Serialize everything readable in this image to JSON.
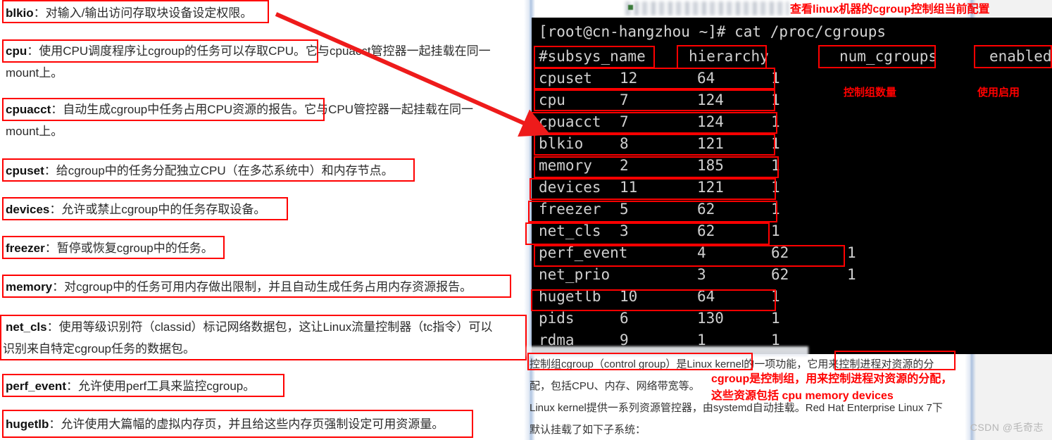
{
  "watermark": "CSDN @毛奇志",
  "article": {
    "entries": [
      {
        "key": "blkio",
        "sep": "：",
        "desc": "对输入/输出访问存取块设备设定权限。"
      },
      {
        "key": "cpu",
        "sep": "：",
        "desc": "使用CPU调度程序让cgroup的任务可以存取CPU。",
        "tail": "它与cpuacct管控器一起挂载在同一",
        "cont": "mount上。"
      },
      {
        "key": "cpuacct",
        "sep": "：",
        "desc": "自动生成cgroup中任务占用CPU资源的报告。",
        "tail": "它与CPU管控器一起挂载在同一",
        "cont": "mount上。"
      },
      {
        "key": "cpuset",
        "sep": "：",
        "desc": "给cgroup中的任务分配独立CPU（在多芯系统中）和内存节点。"
      },
      {
        "key": "devices",
        "sep": "：",
        "desc": "允许或禁止cgroup中的任务存取设备。"
      },
      {
        "key": "freezer",
        "sep": "：",
        "desc": "暂停或恢复cgroup中的任务。"
      },
      {
        "key": "memory",
        "sep": "：",
        "desc": "对cgroup中的任务可用内存做出限制，并且自动生成任务占用内存资源报告。"
      },
      {
        "key": "net_cls",
        "sep": "：",
        "desc": "使用等级识别符（classid）标记网络数据包，这让Linux流量控制器（tc指令）可以",
        "cont": "识别来自特定cgroup任务的数据包。"
      },
      {
        "key": "perf_event",
        "sep": "：",
        "desc": "允许使用perf工具来监控cgroup。"
      },
      {
        "key": "hugetlb",
        "sep": "：",
        "desc": "允许使用大篇幅的虚拟内存页，并且给这些内存页强制设定可用资源量。"
      }
    ]
  },
  "annotations": {
    "title": "查看linux机器的cgroup控制组当前配置",
    "num_cgroups_note": "控制组数量",
    "enabled_note": "使用启用",
    "summary_line1": "cgroup是控制组，用来控制进程对资源的分配，",
    "summary_line2": "这些资源包括 cpu memory devices"
  },
  "terminal": {
    "prompt": "[root@cn-hangzhou ~]# cat /proc/cgroups",
    "headers": {
      "subsys_name": "#subsys_name",
      "hierarchy": "hierarchy",
      "num_cgroups": "num_cgroups",
      "enabled": "enabled"
    },
    "rows": [
      {
        "subsys_name": "cpuset",
        "hierarchy": "12",
        "num_cgroups": "64",
        "enabled": "1",
        "layout": "a"
      },
      {
        "subsys_name": "cpu",
        "hierarchy": "7",
        "num_cgroups": "124",
        "enabled": "1",
        "layout": "a"
      },
      {
        "subsys_name": "cpuacct",
        "hierarchy": "7",
        "num_cgroups": "124",
        "enabled": "1",
        "layout": "a"
      },
      {
        "subsys_name": "blkio",
        "hierarchy": "8",
        "num_cgroups": "121",
        "enabled": "1",
        "layout": "a"
      },
      {
        "subsys_name": "memory",
        "hierarchy": "2",
        "num_cgroups": "185",
        "enabled": "1",
        "layout": "a"
      },
      {
        "subsys_name": "devices",
        "hierarchy": "11",
        "num_cgroups": "121",
        "enabled": "1",
        "layout": "a"
      },
      {
        "subsys_name": "freezer",
        "hierarchy": "5",
        "num_cgroups": "62",
        "enabled": "1",
        "layout": "a"
      },
      {
        "subsys_name": "net_cls",
        "hierarchy": "3",
        "num_cgroups": "62",
        "enabled": "1",
        "layout": "a"
      },
      {
        "subsys_name": "perf_event",
        "hierarchy": "4",
        "num_cgroups": "62",
        "enabled": "1",
        "layout": "b"
      },
      {
        "subsys_name": "net_prio",
        "hierarchy": "3",
        "num_cgroups": "62",
        "enabled": "1",
        "layout": "b"
      },
      {
        "subsys_name": "hugetlb",
        "hierarchy": "10",
        "num_cgroups": "64",
        "enabled": "1",
        "layout": "a"
      },
      {
        "subsys_name": "pids",
        "hierarchy": "6",
        "num_cgroups": "130",
        "enabled": "1",
        "layout": "a"
      },
      {
        "subsys_name": "rdma",
        "hierarchy": "9",
        "num_cgroups": "1",
        "enabled": "1",
        "layout": "a"
      }
    ]
  },
  "bottom_text": {
    "line1_a": "控制组cgroup（control group）",
    "line1_b": "是Linux kernel的一项功能，",
    "line1_c": "它用来控制进程对资源的分",
    "line2": "配，包括CPU、内存、网络带宽等。",
    "line3": "Linux kernel提供一系列资源管控器，由systemd自动挂载。Red Hat Enterprise Linux 7下",
    "line4": "默认挂载了如下子系统："
  },
  "colors": {
    "annotation_red": "#ff0000",
    "terminal_bg": "#000000",
    "terminal_fg": "#d4d4d4",
    "page_bg": "#ffffff"
  }
}
